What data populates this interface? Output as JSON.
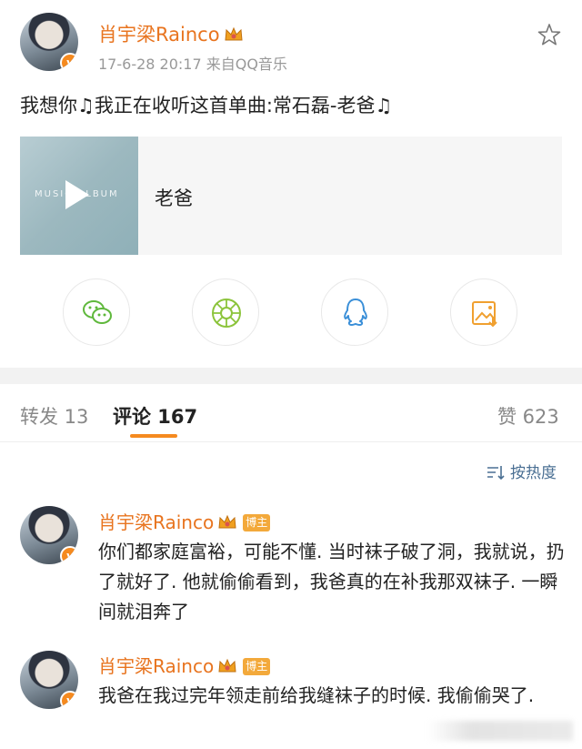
{
  "post": {
    "author": "肖宇梁Rainco",
    "meta": "17-6-28 20:17  来自QQ音乐",
    "text": "我想你♫我正在收听这首单曲:常石磊-老爸♫",
    "music": {
      "cover_text": "MUSIC ALBUM",
      "title": "老爸"
    }
  },
  "share": [
    {
      "name": "wechat",
      "color": "#5fb83c"
    },
    {
      "name": "moments",
      "color": "#8cc43c"
    },
    {
      "name": "qq",
      "color": "#3a8fd8"
    },
    {
      "name": "save-image",
      "color": "#f0a030"
    }
  ],
  "tabs": {
    "repost": "转发 13",
    "comment": "评论 167",
    "like": "赞 623"
  },
  "sort_label": "按热度",
  "comments": [
    {
      "author": "肖宇梁Rainco",
      "tag": "博主",
      "text": "你们都家庭富裕，可能不懂.  当时袜子破了洞，我就说，扔了就好了. 他就偷偷看到，我爸真的在补我那双袜子. 一瞬间就泪奔了"
    },
    {
      "author": "肖宇梁Rainco",
      "tag": "博主",
      "text": "我爸在我过完年领走前给我缝袜子的时候. 我偷偷哭了."
    }
  ]
}
